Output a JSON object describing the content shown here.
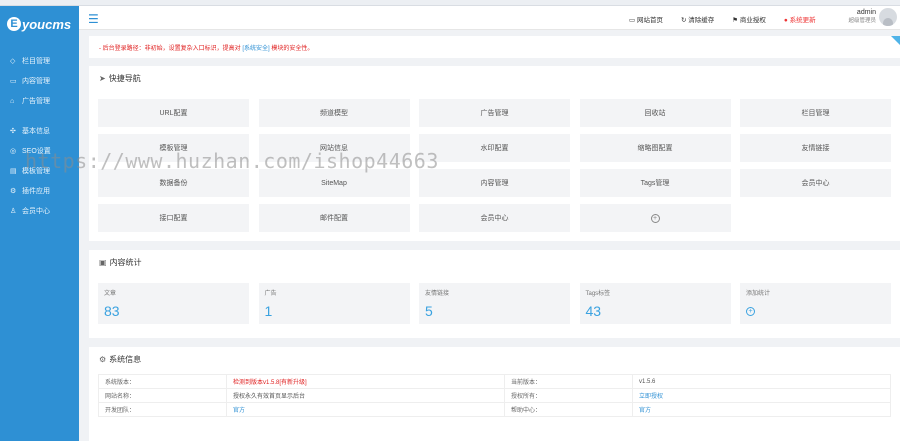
{
  "sidebar": {
    "logo": "youcms",
    "logo_mark": "E",
    "items_top": [
      {
        "icon": "◇",
        "label": "栏目管理"
      },
      {
        "icon": "▭",
        "label": "内容管理"
      },
      {
        "icon": "⌂",
        "label": "广告管理"
      }
    ],
    "items_bottom": [
      {
        "icon": "✣",
        "label": "基本信息"
      },
      {
        "icon": "◎",
        "label": "SEO设置"
      },
      {
        "icon": "▤",
        "label": "模板管理"
      },
      {
        "icon": "⚙",
        "label": "插件应用"
      },
      {
        "icon": "♙",
        "label": "会员中心"
      }
    ]
  },
  "topbar": {
    "menu_icon": "☰",
    "actions": [
      {
        "icon": "▭",
        "label": "网站首页",
        "warn": false
      },
      {
        "icon": "↻",
        "label": "清除缓存",
        "warn": false
      },
      {
        "icon": "⚑",
        "label": "商业授权",
        "warn": false
      },
      {
        "icon": "●",
        "label": "系统更新",
        "warn": true
      }
    ],
    "admin_name": "admin",
    "admin_role": "超级管理员"
  },
  "notice": {
    "text": "- 后台登录路径：非初始，设置复杂入口标识，提高对 ",
    "link": "[系统安全]",
    "text_after": " 模块的安全性。"
  },
  "quick_nav": {
    "title": "快捷导航",
    "icon": "➤",
    "items": [
      "URL配置",
      "频道模型",
      "广告管理",
      "回收站",
      "栏目管理",
      "模板管理",
      "网站信息",
      "水印配置",
      "缩略图配置",
      "友情链接",
      "数据备份",
      "SiteMap",
      "内容管理",
      "Tags管理",
      "会员中心",
      "接口配置",
      "邮件配置",
      "会员中心"
    ],
    "add_icon": "+"
  },
  "stats": {
    "title": "内容统计",
    "icon": "▣",
    "cards": [
      {
        "label": "文章",
        "value": "83"
      },
      {
        "label": "广告",
        "value": "1"
      },
      {
        "label": "友情链接",
        "value": "5"
      },
      {
        "label": "Tags标签",
        "value": "43"
      }
    ],
    "add_card_label": "添加统计",
    "add_icon": "+"
  },
  "system": {
    "title": "系统信息",
    "icon": "⚙",
    "rows": [
      {
        "l1": "系统版本：",
        "v1": "检测到版本v1.5.8[有新升级]",
        "v1_class": "red",
        "l2": "当前版本：",
        "v2": "v1.5.6",
        "v2_class": ""
      },
      {
        "l1": "网站名称：",
        "v1": "授权永久有效首页显示后台",
        "v1_class": "",
        "l2": "授权所有：",
        "v2": "立即授权",
        "v2_class": "blue"
      },
      {
        "l1": "开发团队：",
        "v1": "官方",
        "v1_class": "blue",
        "l2": "帮助中心：",
        "v2": "官方",
        "v2_class": "blue"
      }
    ]
  },
  "watermark": "https://www.huzhan.com/ishop44663"
}
